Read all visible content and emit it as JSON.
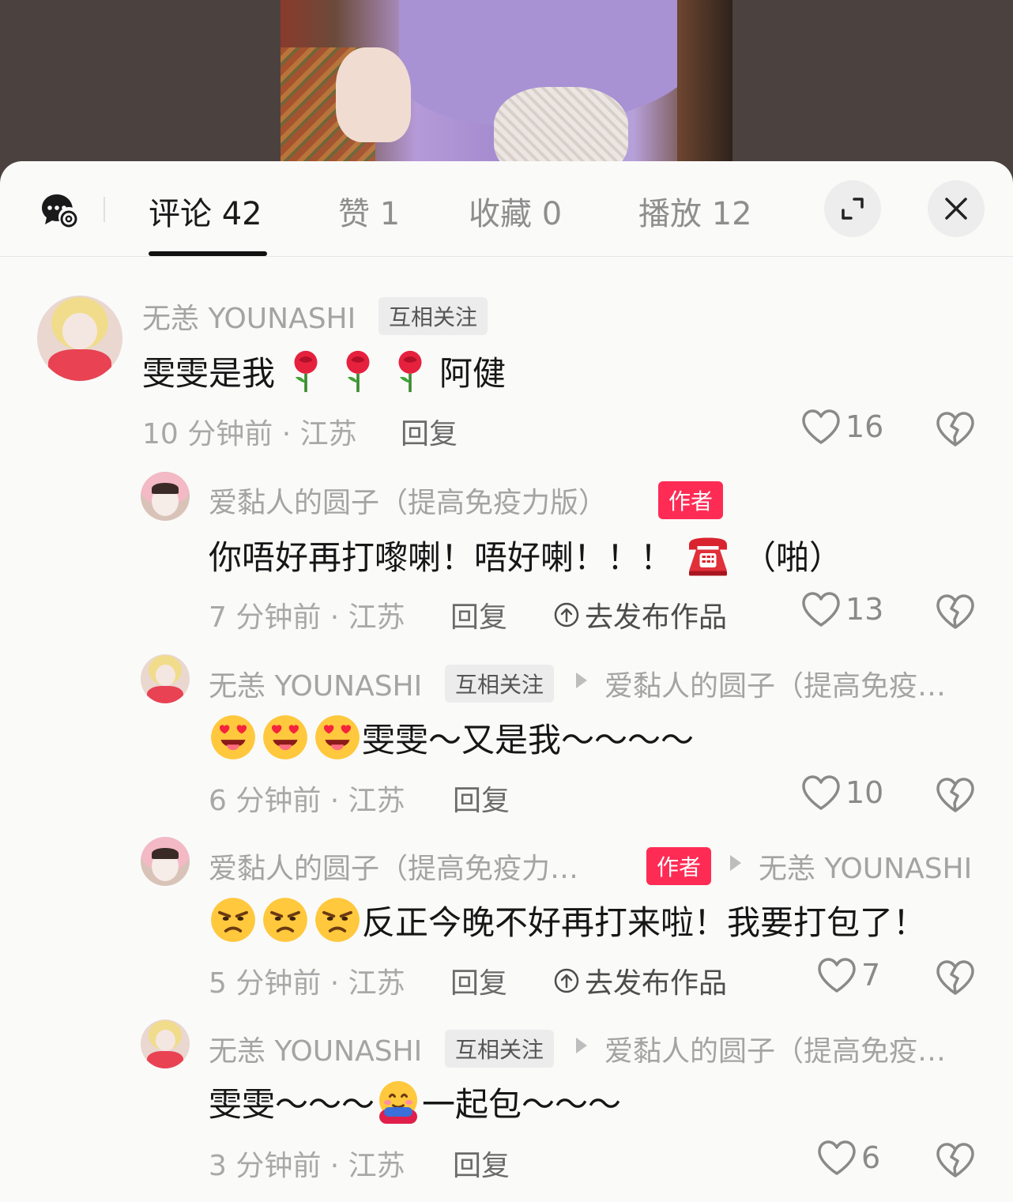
{
  "tabs": [
    {
      "label": "评论",
      "count": "42"
    },
    {
      "label": "赞",
      "count": "1"
    },
    {
      "label": "收藏",
      "count": "0"
    },
    {
      "label": "播放",
      "count": "12"
    }
  ],
  "comments": [
    {
      "user": "无恙 YOUNASHI",
      "badge": "互相关注",
      "text_parts": [
        "雯雯是我",
        "阿健"
      ],
      "time_location": "10 分钟前 · 江苏",
      "reply": "回复",
      "likes": "16"
    },
    {
      "user": "爱黏人的圆子（提高免疫力版）",
      "badge": "作者",
      "text_parts": [
        "你唔好再打嚟喇！唔好喇！！！",
        "（啪）"
      ],
      "time_location": "7 分钟前 · 江苏",
      "reply": "回复",
      "publish": "去发布作品",
      "likes": "13"
    },
    {
      "user": "无恙 YOUNASHI",
      "badge": "互相关注",
      "reply_to": "爱黏人的圆子（提高免疫…",
      "text_parts": [
        "雯雯～又是我～～～～"
      ],
      "time_location": "6 分钟前 · 江苏",
      "reply": "回复",
      "likes": "10"
    },
    {
      "user": "爱黏人的圆子（提高免疫力…",
      "badge": "作者",
      "reply_to": "无恙 YOUNASHI",
      "text_parts": [
        "反正今晚不好再打来啦！我要打包了！"
      ],
      "time_location": "5 分钟前 · 江苏",
      "reply": "回复",
      "publish": "去发布作品",
      "likes": "7"
    },
    {
      "user": "无恙 YOUNASHI",
      "badge": "互相关注",
      "reply_to": "爱黏人的圆子（提高免疫…",
      "text_parts": [
        "雯雯～～～",
        "一起包～～～"
      ],
      "time_location": "3 分钟前 · 江苏",
      "reply": "回复",
      "likes": "6"
    }
  ],
  "icons": {
    "rose": "rose-emoji",
    "telephone": "telephone-emoji",
    "heart_eyes_tongue": "heart-eyes-tongue-emoji",
    "annoyed": "annoyed-face-emoji",
    "hug": "hugging-emoji"
  },
  "colors": {
    "author_badge": "#fe2c55",
    "active_tab": "#1a1a1a",
    "inactive_tab": "#8e8e8e"
  }
}
